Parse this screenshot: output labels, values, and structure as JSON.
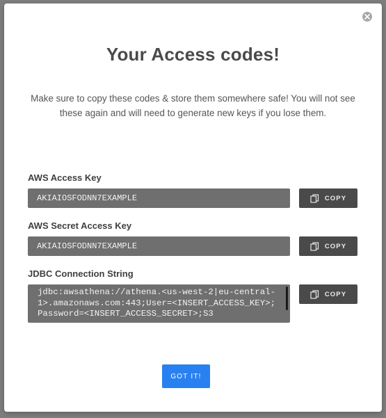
{
  "modal": {
    "title": "Your Access codes!",
    "subtitle": "Make sure to copy these codes & store them somewhere safe! You will not see these again and will need to generate new keys if you lose them."
  },
  "fields": [
    {
      "label": "AWS Access Key",
      "value": "AKIAIOSFODNN7EXAMPLE",
      "copy_label": "COPY"
    },
    {
      "label": "AWS Secret Access Key",
      "value": "AKIAIOSFODNN7EXAMPLE",
      "copy_label": "COPY"
    },
    {
      "label": "JDBC Connection String",
      "value": "jdbc:awsathena://athena.<us-west-2|eu-central-1>.amazonaws.com:443;User=<INSERT_ACCESS_KEY>;Password=<INSERT_ACCESS_SECRET>;S3",
      "copy_label": "COPY"
    }
  ],
  "confirm_button": {
    "label": "GOT IT!",
    "color": "#2980f0"
  },
  "icons": {
    "close": "close-icon",
    "copy": "copy-icon"
  }
}
